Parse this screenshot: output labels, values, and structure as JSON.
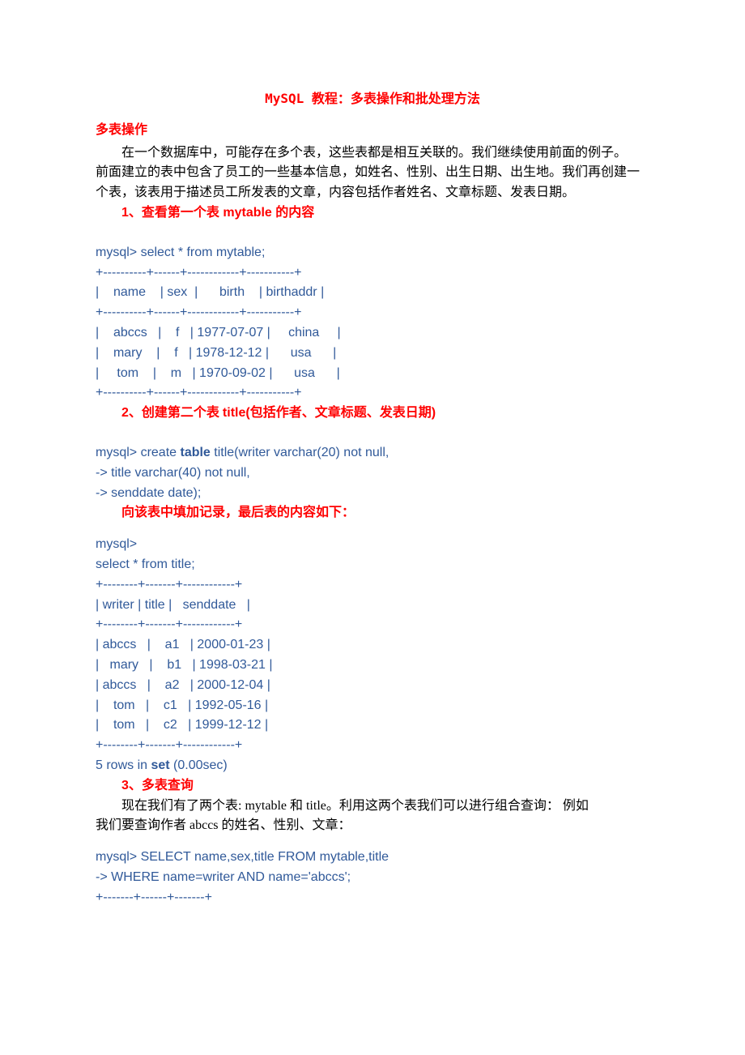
{
  "title": "MySQL 教程：多表操作和批处理方法",
  "s1": {
    "header": "多表操作",
    "p1a": "在一个数据库中，可能存在多个表，这些表都是相互关联的。我们继续使用前面的例子。",
    "p1b": "前面建立的表中包含了员工的一些基本信息，如姓名、性别、出生日期、出生地。我们再创建一个表，该表用于描述员工所发表的文章，内容包括作者姓名、文章标题、发表日期。"
  },
  "step1": {
    "label_num": "1、",
    "label_a": "查看第一个表 ",
    "label_b": "mytable ",
    "label_c": "的内容",
    "code": "mysql> select * from mytable;\n+----------+------+------------+-----------+\n|    name    | sex  |      birth    | birthaddr |\n+----------+------+------------+-----------+\n|    abccs   |    f   | 1977-07-07 |     china     |\n|    mary    |    f   | 1978-12-12 |      usa      |\n|     tom    |    m   | 1970-09-02 |      usa      |\n+----------+------+------------+-----------+"
  },
  "step2": {
    "label_num": "2、",
    "label_a": "创建第二个表 ",
    "label_b": "title(",
    "label_c": "包括作者、文章标题、发表日期",
    "label_d": ")",
    "code_pre": "mysql> create ",
    "code_kw": "table",
    "code_post": " title(writer varchar(20) not null,\n-> title varchar(40) not null,\n-> senddate date);",
    "note": "向该表中填加记录，最后表的内容如下：",
    "code2_pre": "mysql>\nselect * from title;\n+--------+-------+------------+\n| writer | title |   senddate   |\n+--------+-------+------------+\n| abccs   |    a1   | 2000-01-23 |\n|   mary   |    b1   | 1998-03-21 |\n| abccs   |    a2   | 2000-12-04 |\n|    tom   |    c1   | 1992-05-16 |\n|    tom   |    c2   | 1999-12-12 |\n+--------+-------+------------+\n5 rows in ",
    "code2_kw": "set",
    "code2_post": " (0.00sec)"
  },
  "step3": {
    "label_num": "3、",
    "label_text": "多表查询",
    "p1a": "现在我们有了两个表: mytable 和 title。利用这两个表我们可以进行组合查询：  例如",
    "p1b": "我们要查询作者 abccs 的姓名、性别、文章：",
    "code": "mysql> SELECT name,sex,title FROM mytable,title\n-> WHERE name=writer AND name='abccs';\n+-------+------+-------+"
  }
}
